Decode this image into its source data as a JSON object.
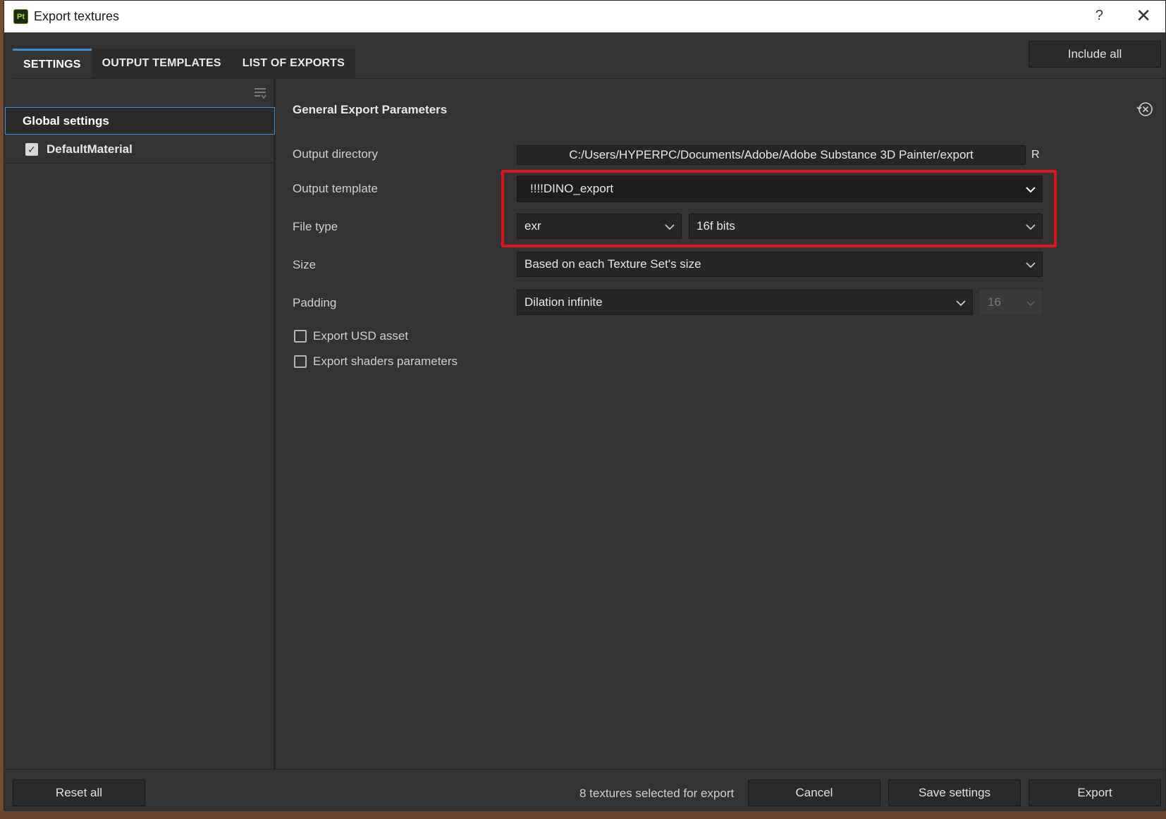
{
  "window": {
    "app_logo": "Pt",
    "title": "Export textures",
    "help": "?",
    "close": "✕"
  },
  "tabs": [
    {
      "label": "SETTINGS",
      "active": true
    },
    {
      "label": "OUTPUT TEMPLATES",
      "active": false
    },
    {
      "label": "LIST OF EXPORTS",
      "active": false
    }
  ],
  "include_all_label": "Include all",
  "sidebar": {
    "items": [
      {
        "label": "Global settings",
        "selected": true
      },
      {
        "label": "DefaultMaterial",
        "checked": true
      }
    ]
  },
  "main": {
    "section_title": "General Export Parameters",
    "output_directory": {
      "label": "Output directory",
      "value": "C:/Users/HYPERPC/Documents/Adobe/Adobe Substance 3D Painter/export",
      "reset_label": "R"
    },
    "output_template": {
      "label": "Output template",
      "value": "!!!!DINO_export"
    },
    "file_type": {
      "label": "File type",
      "format": "exr",
      "bit_depth": "16f bits"
    },
    "size": {
      "label": "Size",
      "value": "Based on each Texture Set's size"
    },
    "padding": {
      "label": "Padding",
      "value": "Dilation infinite",
      "amount": "16"
    },
    "export_usd": {
      "label": "Export USD asset",
      "checked": false
    },
    "export_shaders": {
      "label": "Export shaders parameters",
      "checked": false
    }
  },
  "footer": {
    "reset_all": "Reset all",
    "status": "8 textures selected for export",
    "cancel": "Cancel",
    "save_settings": "Save settings",
    "export": "Export"
  },
  "colors": {
    "accent": "#3b8fd9",
    "highlight": "#e0141e",
    "panel": "#333333",
    "field": "#262626"
  }
}
